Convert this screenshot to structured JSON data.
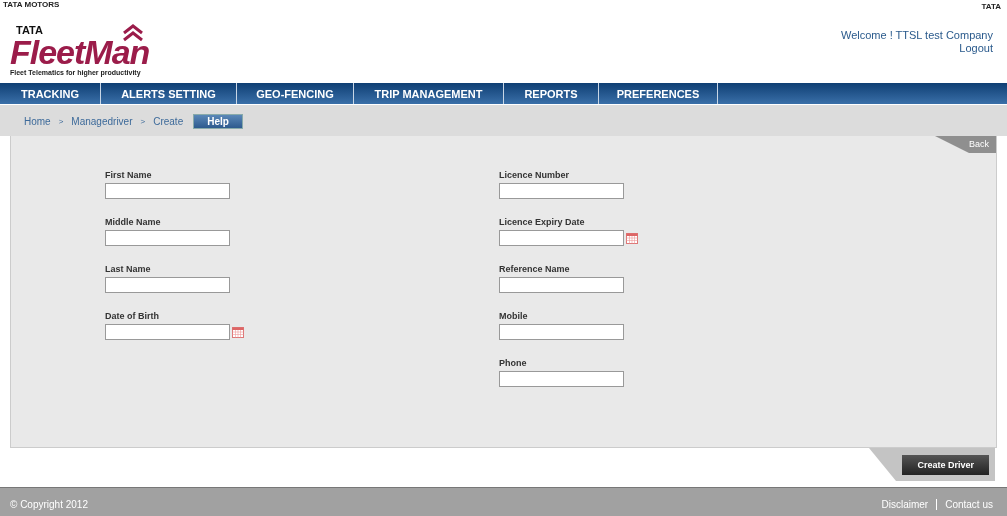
{
  "header": {
    "brand_top": "TATA MOTORS",
    "logo_small": "TATA",
    "logo_name": "FleetMan",
    "tagline": "Fleet Telematics for higher productivity",
    "corner_logo": "TATA",
    "welcome": "Welcome ! TTSL test Company",
    "logout": "Logout"
  },
  "nav": [
    "TRACKING",
    "ALERTS SETTING",
    "GEO-FENCING",
    "TRIP MANAGEMENT",
    "REPORTS",
    "PREFERENCES"
  ],
  "breadcrumb": {
    "items": [
      "Home",
      "Managedriver",
      "Create"
    ],
    "separator": ">",
    "help": "Help"
  },
  "form": {
    "back": "Back",
    "columns": [
      [
        {
          "label": "First Name",
          "kind": "text"
        },
        {
          "label": "Middle Name",
          "kind": "text"
        },
        {
          "label": "Last Name",
          "kind": "text"
        },
        {
          "label": "Date of Birth",
          "kind": "date"
        }
      ],
      [
        {
          "label": "Licence Number",
          "kind": "text"
        },
        {
          "label": "Licence Expiry Date",
          "kind": "date"
        },
        {
          "label": "Reference Name",
          "kind": "text"
        },
        {
          "label": "Mobile",
          "kind": "text"
        },
        {
          "label": "Phone",
          "kind": "text"
        }
      ]
    ],
    "submit": "Create Driver"
  },
  "footer": {
    "copyright": "© Copyright 2012",
    "links": [
      "Disclaimer",
      "Contact us"
    ]
  }
}
